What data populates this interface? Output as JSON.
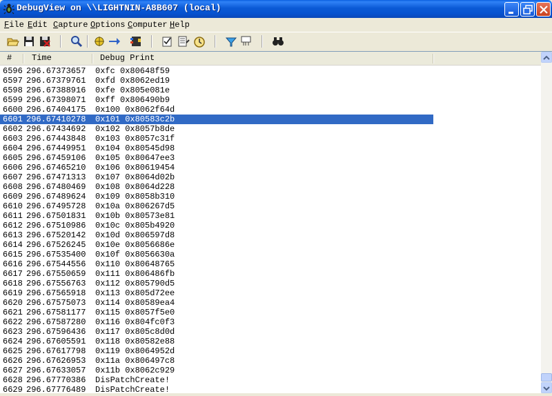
{
  "window": {
    "title": "DebugView on \\\\LIGHTNIN-A8B607 (local)",
    "accent": "#0A5FE0",
    "selection_color": "#316AC5"
  },
  "menu": {
    "items": [
      {
        "acc": "F",
        "rest": "ile"
      },
      {
        "acc": "E",
        "rest": "dit"
      },
      {
        "acc": "C",
        "rest": "apture"
      },
      {
        "acc": "O",
        "rest": "ptions"
      },
      {
        "acc": "C",
        "rest": "omputer"
      },
      {
        "acc": "H",
        "rest": "elp"
      }
    ]
  },
  "toolbar": {
    "icons": [
      "open-icon",
      "save-icon",
      "clear-icon",
      "find-icon",
      "capture-icon",
      "autoscroll-icon",
      "capture-kernel-icon",
      "highlight-icon",
      "filter-icon",
      "history-depth-icon",
      "time-icon",
      "capture-win32-icon",
      "capture-events-icon",
      "binoculars-icon"
    ]
  },
  "list": {
    "columns": {
      "num": "#",
      "time": "Time",
      "msg": "Debug Print"
    },
    "selected_index": 5,
    "rows": [
      [
        "6596",
        "296.67373657",
        "0xfc 0x80648f59"
      ],
      [
        "6597",
        "296.67379761",
        "0xfd 0x8062ed19"
      ],
      [
        "6598",
        "296.67388916",
        "0xfe 0x805e081e"
      ],
      [
        "6599",
        "296.67398071",
        "0xff 0x806490b9"
      ],
      [
        "6600",
        "296.67404175",
        "0x100 0x8062f64d"
      ],
      [
        "6601",
        "296.67410278",
        "0x101 0x80583c2b"
      ],
      [
        "6602",
        "296.67434692",
        "0x102 0x8057b8de"
      ],
      [
        "6603",
        "296.67443848",
        "0x103 0x8057c31f"
      ],
      [
        "6604",
        "296.67449951",
        "0x104 0x80545d98"
      ],
      [
        "6605",
        "296.67459106",
        "0x105 0x80647ee3"
      ],
      [
        "6606",
        "296.67465210",
        "0x106 0x80619454"
      ],
      [
        "6607",
        "296.67471313",
        "0x107 0x8064d02b"
      ],
      [
        "6608",
        "296.67480469",
        "0x108 0x8064d228"
      ],
      [
        "6609",
        "296.67489624",
        "0x109 0x8058b310"
      ],
      [
        "6610",
        "296.67495728",
        "0x10a 0x806267d5"
      ],
      [
        "6611",
        "296.67501831",
        "0x10b 0x80573e81"
      ],
      [
        "6612",
        "296.67510986",
        "0x10c 0x805b4920"
      ],
      [
        "6613",
        "296.67520142",
        "0x10d 0x806597d8"
      ],
      [
        "6614",
        "296.67526245",
        "0x10e 0x8056686e"
      ],
      [
        "6615",
        "296.67535400",
        "0x10f 0x8056630a"
      ],
      [
        "6616",
        "296.67544556",
        "0x110 0x80648765"
      ],
      [
        "6617",
        "296.67550659",
        "0x111 0x806486fb"
      ],
      [
        "6618",
        "296.67556763",
        "0x112 0x805790d5"
      ],
      [
        "6619",
        "296.67565918",
        "0x113 0x805d72ee"
      ],
      [
        "6620",
        "296.67575073",
        "0x114 0x80589ea4"
      ],
      [
        "6621",
        "296.67581177",
        "0x115 0x8057f5e0"
      ],
      [
        "6622",
        "296.67587280",
        "0x116 0x804fc0f3"
      ],
      [
        "6623",
        "296.67596436",
        "0x117 0x805c8d0d"
      ],
      [
        "6624",
        "296.67605591",
        "0x118 0x80582e88"
      ],
      [
        "6625",
        "296.67617798",
        "0x119 0x8064952d"
      ],
      [
        "6626",
        "296.67626953",
        "0x11a 0x806497c8"
      ],
      [
        "6627",
        "296.67633057",
        "0x11b 0x8062c929"
      ],
      [
        "6628",
        "296.67770386",
        "DisPatchCreate!"
      ],
      [
        "6629",
        "296.67776489",
        "DisPatchCreate!"
      ]
    ]
  }
}
